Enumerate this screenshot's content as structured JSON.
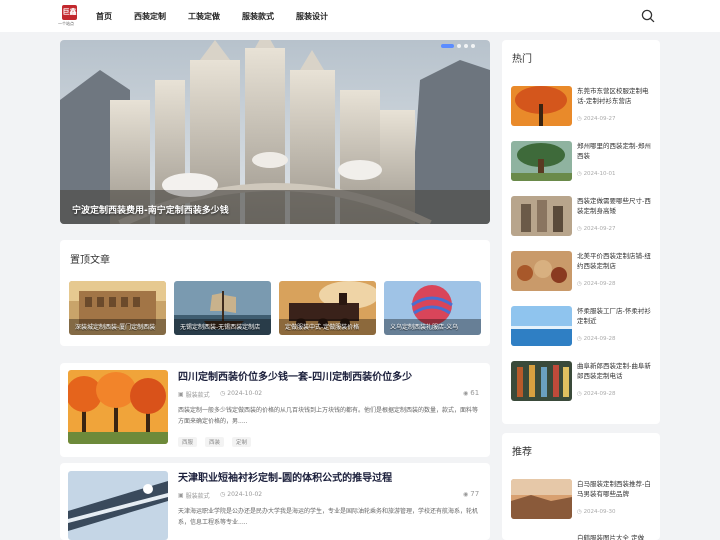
{
  "header": {
    "logo_text": "巨鑫",
    "logo_sub": "一个站点",
    "nav": [
      "首页",
      "西装定制",
      "工装定做",
      "服装款式",
      "服装设计"
    ]
  },
  "hero": {
    "title": "宁波定制西装费用-南宁定制西装多少钱"
  },
  "pinned": {
    "title": "置顶文章",
    "items": [
      "深装城定制西装-厦门定制西装",
      "无锡定制西装-无锡西装定制店",
      "定做服装中式-定做服装价格",
      "义乌定制西装礼服店-义乌"
    ]
  },
  "articles": [
    {
      "title": "四川定制西装价位多少钱一套-四川定制西装价位多少",
      "category": "服装款式",
      "date": "2024-10-02",
      "views": "61",
      "excerpt": "西装定制一般多少钱定做西装的价格的从几百块钱到上万块钱的都有。他们是根据定制西装的数量，款式，面料等方面来确定价格的，男.....",
      "tags": [
        "西服",
        "西装",
        "定制"
      ]
    },
    {
      "title": "天津职业短袖衬衫定制-圆的体积公式的推导过程",
      "category": "服装款式",
      "date": "2024-10-02",
      "views": "77",
      "excerpt": "天津海运职业学院是公办还是民办大学我是海运的学生，专业是国际油轮乘务和旅游管理，学校还有航海系，轮机系，信息工程系等专业.....",
      "tags": []
    }
  ],
  "hot": {
    "title": "热门",
    "items": [
      {
        "title": "东莞市东营区校服定制电话-定制衬衫东营店",
        "date": "2024-09-27"
      },
      {
        "title": "郑州哪里的西装定制-郑州 西装",
        "date": "2024-10-01"
      },
      {
        "title": "西装定做需要哪些尺寸-西装定制身高矮",
        "date": "2024-09-27"
      },
      {
        "title": "北美平价西装定制店铺-纽约西装定制店",
        "date": "2024-09-28"
      },
      {
        "title": "怀柔服装工厂店-怀柔衬衫定制近",
        "date": "2024-09-28"
      },
      {
        "title": "曲阜新郎西装定制-曲阜新郎西装定制电话",
        "date": "2024-09-28"
      }
    ]
  },
  "recommend": {
    "title": "推荐",
    "items": [
      {
        "title": "白马服装定制西装推荐-白马男装有哪些品牌",
        "date": "2024-09-30"
      },
      {
        "title": "白鹤服装图片大全 定做",
        "date": ""
      }
    ]
  },
  "colors": {
    "accent": "#5b8cff",
    "logo": "#c2272d",
    "title": "#1b1f3b"
  }
}
